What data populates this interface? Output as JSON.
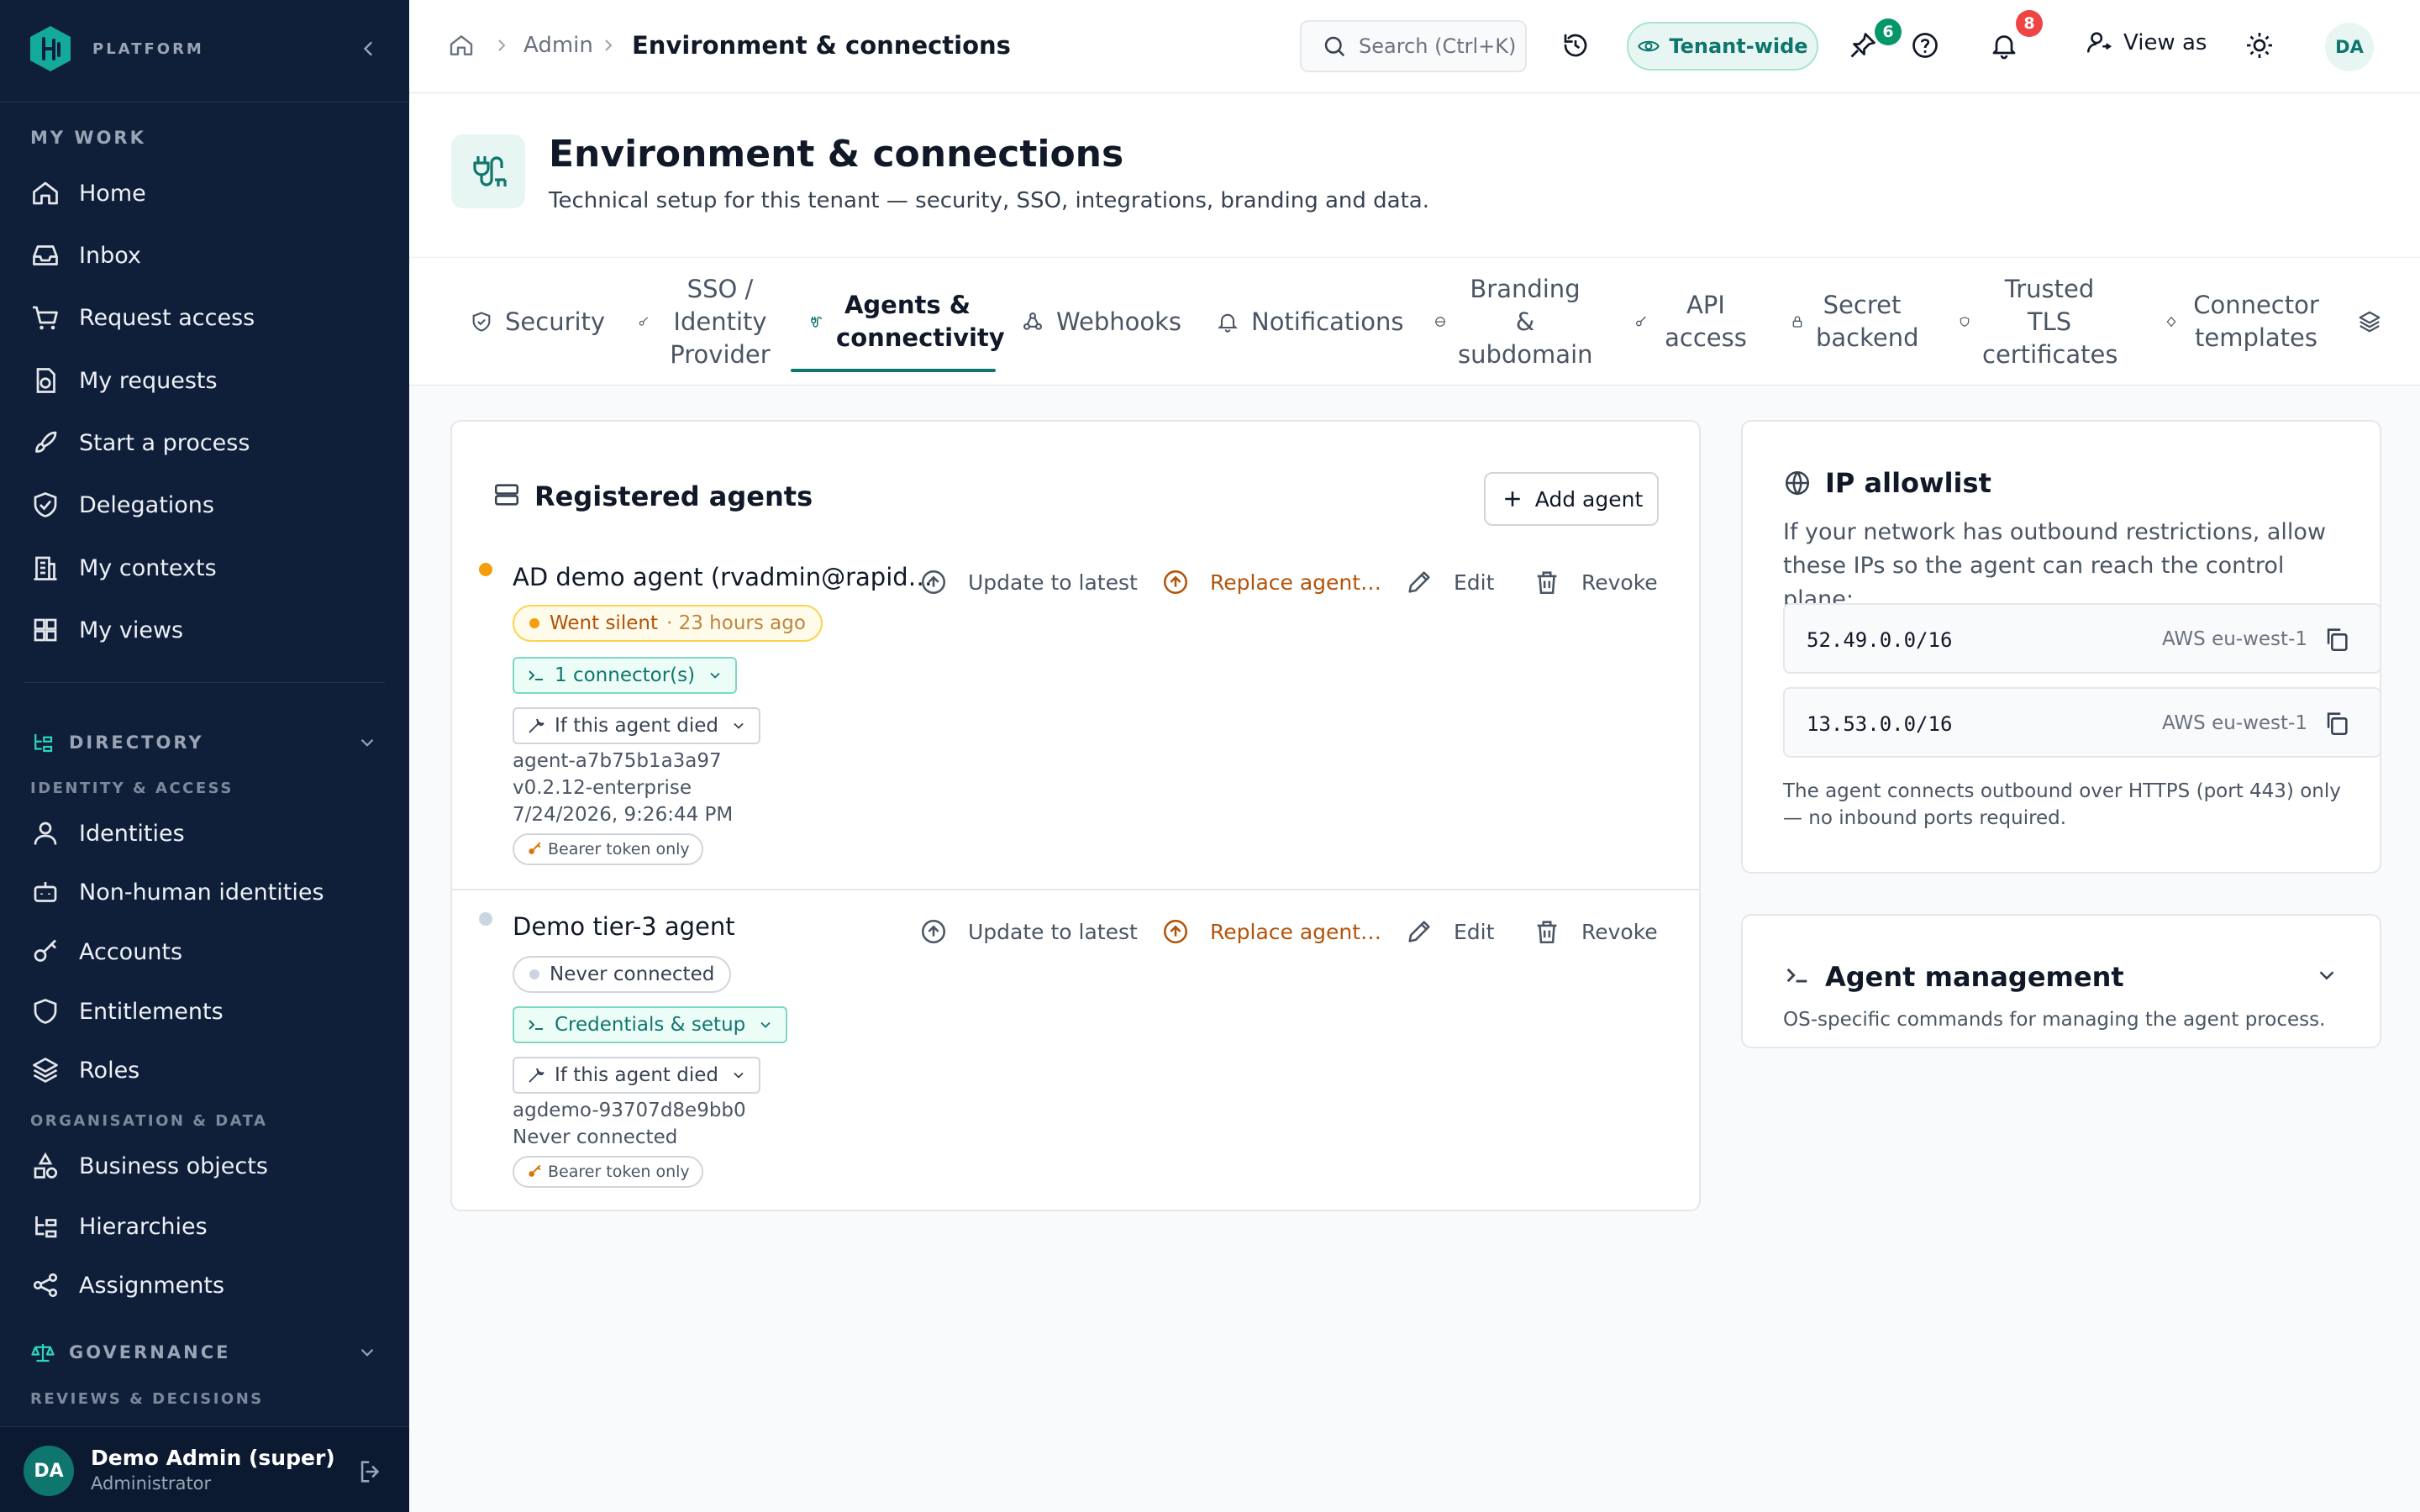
{
  "sidebar": {
    "brand": "PLATFORM",
    "my_work_heading": "MY WORK",
    "my_work": [
      {
        "label": "Home",
        "icon": "home-icon"
      },
      {
        "label": "Inbox",
        "icon": "inbox-icon"
      },
      {
        "label": "Request access",
        "icon": "cart-icon"
      },
      {
        "label": "My requests",
        "icon": "requests-icon"
      },
      {
        "label": "Start a process",
        "icon": "rocket-icon"
      },
      {
        "label": "Delegations",
        "icon": "delegation-icon"
      },
      {
        "label": "My contexts",
        "icon": "building-icon"
      },
      {
        "label": "My views",
        "icon": "grid-icon"
      }
    ],
    "directory": {
      "label": "DIRECTORY",
      "subheading_identity": "IDENTITY & ACCESS",
      "identity_items": [
        {
          "label": "Identities",
          "icon": "user-icon"
        },
        {
          "label": "Non-human identities",
          "icon": "bot-icon"
        },
        {
          "label": "Accounts",
          "icon": "key-icon"
        },
        {
          "label": "Entitlements",
          "icon": "shield-icon"
        },
        {
          "label": "Roles",
          "icon": "layers-icon"
        }
      ],
      "subheading_org": "ORGANISATION & DATA",
      "org_items": [
        {
          "label": "Business objects",
          "icon": "shapes-icon"
        },
        {
          "label": "Hierarchies",
          "icon": "hierarchy-icon"
        },
        {
          "label": "Assignments",
          "icon": "share-icon"
        }
      ]
    },
    "governance": {
      "label": "GOVERNANCE",
      "subheading": "REVIEWS & DECISIONS"
    },
    "user": {
      "initials": "DA",
      "name": "Demo Admin (super)",
      "role": "Administrator"
    }
  },
  "topbar": {
    "breadcrumb": {
      "parent": "Admin",
      "current": "Environment & connections"
    },
    "search_placeholder": "Search (Ctrl+K)",
    "scope_pill": "Tenant-wide",
    "pinned_badge": "6",
    "notifications_badge": "8",
    "view_as": "View as",
    "avatar_initials": "DA"
  },
  "page": {
    "title": "Environment & connections",
    "description": "Technical setup for this tenant — security, SSO, integrations, branding and data."
  },
  "tabs": [
    {
      "label": "Security",
      "icon": "shield-check-icon"
    },
    {
      "label": "SSO / Identity Provider",
      "icon": "key-icon"
    },
    {
      "label": "Agents & connectivity",
      "icon": "cable-icon",
      "active": true
    },
    {
      "label": "Webhooks",
      "icon": "webhook-icon"
    },
    {
      "label": "Notifications",
      "icon": "bell-icon"
    },
    {
      "label": "Branding & subdomain",
      "icon": "globe-icon"
    },
    {
      "label": "API access",
      "icon": "key-icon"
    },
    {
      "label": "Secret backend",
      "icon": "lock-icon"
    },
    {
      "label": "Trusted TLS certificates",
      "icon": "shield-icon"
    },
    {
      "label": "Connector templates",
      "icon": "puzzle-icon"
    },
    {
      "label": "",
      "icon": "layers-icon"
    }
  ],
  "agents_card": {
    "title": "Registered agents",
    "add_button": "Add agent",
    "actions": {
      "update": "Update to latest",
      "replace": "Replace agent…",
      "edit": "Edit",
      "revoke": "Revoke"
    },
    "agents": [
      {
        "name": "AD demo agent (rvadmin@rapid…",
        "status": "Went silent",
        "status_detail": "· 23 hours ago",
        "status_color": "#f59e0b",
        "connector_chip": "1 connector(s)",
        "died_chip": "If this agent died",
        "id": "agent-a7b75b1a3a97",
        "version": "v0.2.12-enterprise",
        "last_seen": "7/24/2026, 9:26:44 PM",
        "auth": "Bearer token only"
      },
      {
        "name": "Demo tier-3 agent",
        "status": "Never connected",
        "status_color": "#cbd5e1",
        "connector_chip": "Credentials & setup",
        "died_chip": "If this agent died",
        "id": "agdemo-93707d8e9bb0",
        "last_seen": "Never connected",
        "auth": "Bearer token only"
      }
    ]
  },
  "ip_card": {
    "title": "IP allowlist",
    "description": "If your network has outbound restrictions, allow these IPs so the agent can reach the control plane:",
    "ips": [
      {
        "cidr": "52.49.0.0/16",
        "region": "AWS eu-west-1"
      },
      {
        "cidr": "13.53.0.0/16",
        "region": "AWS eu-west-1"
      }
    ],
    "note": "The agent connects outbound over HTTPS (port 443) only — no inbound ports required."
  },
  "mgmt_card": {
    "title": "Agent management",
    "description": "OS-specific commands for managing the agent process."
  },
  "colors": {
    "sidebar_bg": "#0f1f3a",
    "accent": "#0f766e",
    "warning": "#b45309",
    "badge_green": "#059669",
    "badge_red": "#ef4444"
  }
}
